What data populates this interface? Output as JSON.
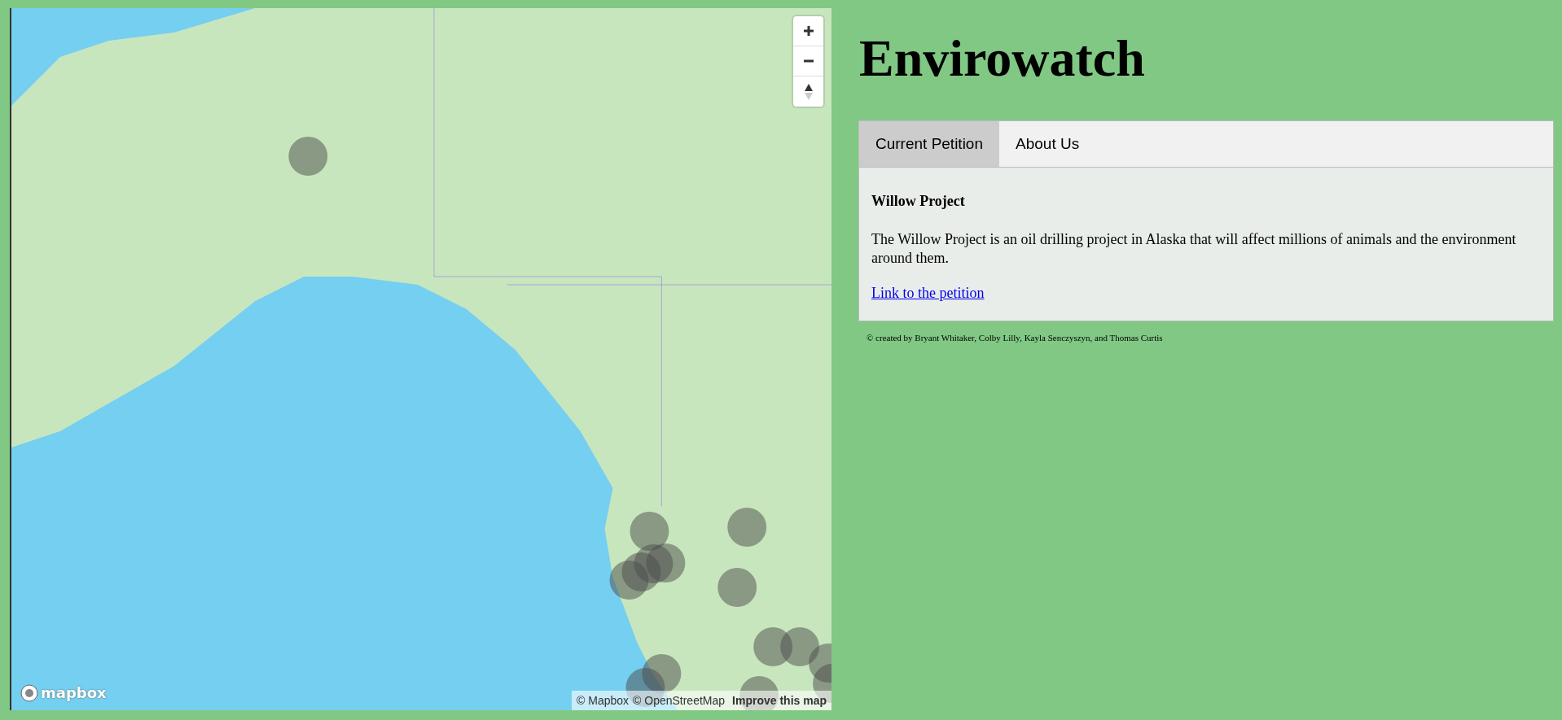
{
  "map": {
    "logo": "mapbox",
    "attribution": [
      {
        "label": "© Mapbox",
        "kind": "link"
      },
      {
        "label": "© OpenStreetMap",
        "kind": "link"
      },
      {
        "label": "Improve this map",
        "kind": "feedback"
      }
    ]
  },
  "title": "Envirowatch",
  "tabs": [
    {
      "label": "Current Petition",
      "selected": true
    },
    {
      "label": "About Us",
      "selected": false
    }
  ],
  "petition": {
    "heading": "Willow Project",
    "description": "The Willow Project is an oil drilling project in Alaska that will affect millions of animals and the environment around them.",
    "link": "Link to the petition"
  },
  "footer": "© created by Bryant Whitaker, Colby Lilly, Kayla Senczyszyn, and Thomas Curtis"
}
